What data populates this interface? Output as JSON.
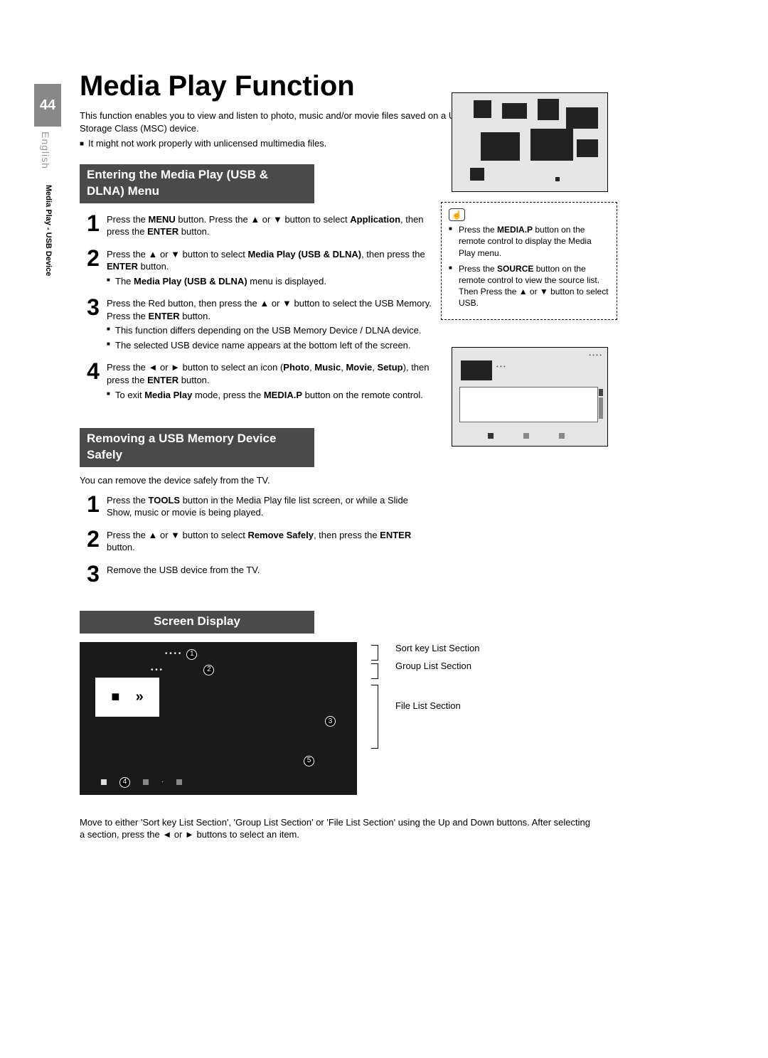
{
  "page_number": "44",
  "side_language": "English",
  "side_chapter": "Media Play - USB Device",
  "title": "Media Play Function",
  "intro": "This function enables you to view and listen to photo, music and/or movie files saved on a USB Mass Storage Class (MSC) device.",
  "intro_note": "It might not work properly with unlicensed multimedia files.",
  "sec1_head": "Entering the Media Play (USB & DLNA) Menu",
  "sec1": {
    "s1_a": "Press the ",
    "s1_b": "MENU",
    "s1_c": " button. Press the ▲ or ▼ button to select ",
    "s1_d": "Application",
    "s1_e": ", then press the ",
    "s1_f": "ENTER",
    "s1_g": "        button.",
    "s2_a": "Press the  ▲ or ▼ button to select ",
    "s2_b": "Media Play (USB & DLNA)",
    "s2_c": ", then press the ",
    "s2_d": "ENTER",
    "s2_e": "        button.",
    "s2_sub": "The Media Play (USB & DLNA) menu is displayed.",
    "s2_sub_pre": "The ",
    "s2_sub_bold": "Media Play (USB & DLNA)",
    "s2_sub_post": " menu is displayed.",
    "s3_a": "Press the Red button, then press the  ▲ or ▼ button to select the USB Memory. Press the ",
    "s3_b": "ENTER",
    "s3_c": "        button.",
    "s3_sub1": "This function differs depending on the USB Memory Device / DLNA device.",
    "s3_sub2": "The selected USB device name appears at the bottom left of the screen.",
    "s4_a": "Press the  ◄ or ► button to select an icon (",
    "s4_b": "Photo",
    "s4_c": ", ",
    "s4_d": "Music",
    "s4_e": ", ",
    "s4_f": "Movie",
    "s4_g": ", ",
    "s4_h": "Setup",
    "s4_i": "), then press the ",
    "s4_j": "ENTER",
    "s4_k": "        button.",
    "s4_sub_a": "To exit ",
    "s4_sub_b": "Media Play",
    "s4_sub_c": " mode, press the ",
    "s4_sub_d": "MEDIA.P",
    "s4_sub_e": " button on the remote control."
  },
  "info": {
    "li1_a": "Press the ",
    "li1_b": "MEDIA.P",
    "li1_c": " button on the remote control to display the Media Play menu.",
    "li2_a": "Press the ",
    "li2_b": "SOURCE",
    "li2_c": " button on the remote control to view the source list. Then Press the ▲ or ▼ button to select USB."
  },
  "sec2_head": "Removing a USB Memory Device Safely",
  "sec2_intro": "You can remove the device safely from the TV.",
  "sec2": {
    "s1_a": "Press the ",
    "s1_b": "TOOLS",
    "s1_c": " button in the Media Play file list screen, or while a Slide Show, music or movie is being played.",
    "s2_a": "Press the  ▲ or ▼ button to select ",
    "s2_b": "Remove Safely",
    "s2_c": ", then press the ",
    "s2_d": "ENTER",
    "s2_e": " button.",
    "s3": "Remove the USB device from the TV."
  },
  "sec3_head": "Screen Display",
  "sd_labels": {
    "l1": "Sort key List Section",
    "l2": "Group List Section",
    "l3": "File List Section"
  },
  "footnote": "Move to either 'Sort key List Section', 'Group List Section' or 'File List Section' using the Up and Down buttons. After selecting a section, press the ◄ or ► buttons to select an item."
}
